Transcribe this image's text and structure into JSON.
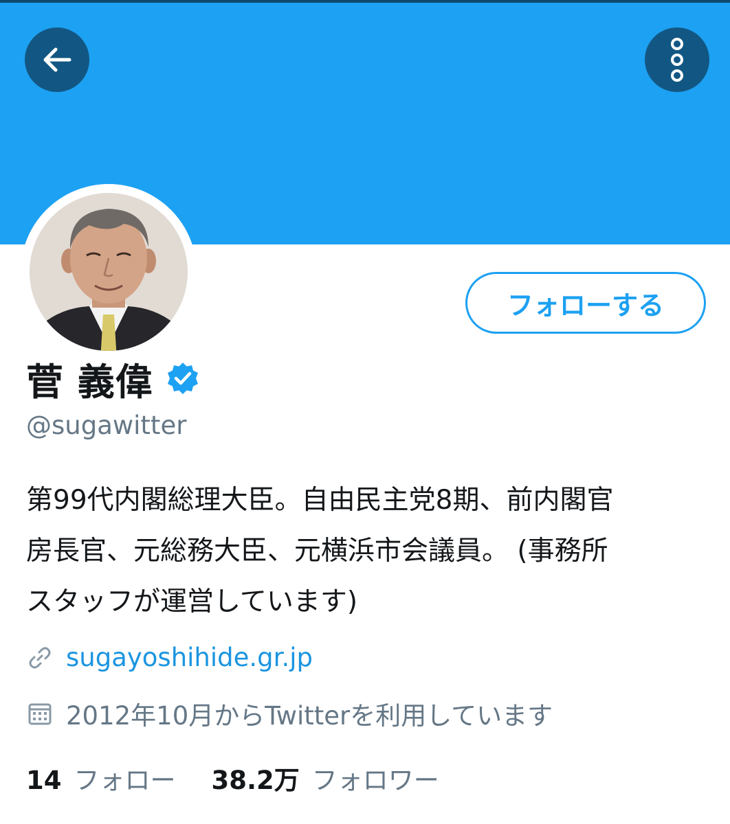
{
  "header": {
    "back_icon": "arrow-left-icon",
    "more_icon": "more-vertical-icon",
    "banner_color": "#1da1f2",
    "button_bg": "#125783"
  },
  "profile": {
    "display_name": "菅 義偉",
    "verified": true,
    "handle": "@sugawitter",
    "follow_label": "フォローする",
    "bio_lines": [
      "第99代内閣総理大臣。自由民主党8期、前内閣官",
      "房長官、元総務大臣、元横浜市会議員。 (事務所",
      "スタッフが運営しています)"
    ],
    "website": "sugayoshihide.gr.jp",
    "joined": "2012年10月からTwitterを利用しています"
  },
  "stats": {
    "following_count": "14",
    "following_label": "フォロー",
    "followers_count": "38.2万",
    "followers_label": "フォロワー"
  },
  "colors": {
    "accent": "#1da1f2",
    "link": "#1b95e0",
    "secondary_text": "#657786",
    "primary_text": "#14171a"
  }
}
